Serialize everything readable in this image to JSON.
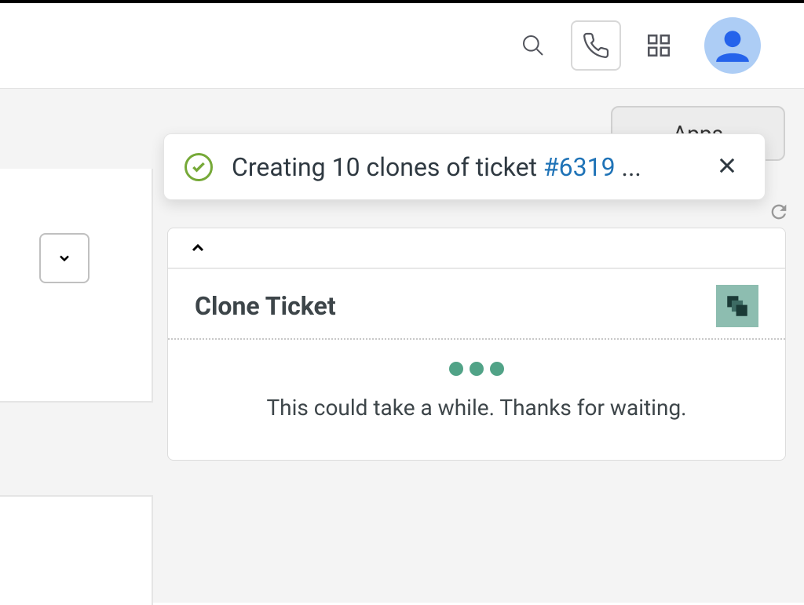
{
  "header": {
    "apps_label": "Apps"
  },
  "toast": {
    "prefix": "Creating 10 clones of ticket ",
    "ticket_number": "#6319",
    "suffix": " ..."
  },
  "panel": {
    "title": "Clone Ticket",
    "wait_message": "This could take a while. Thanks for waiting."
  }
}
